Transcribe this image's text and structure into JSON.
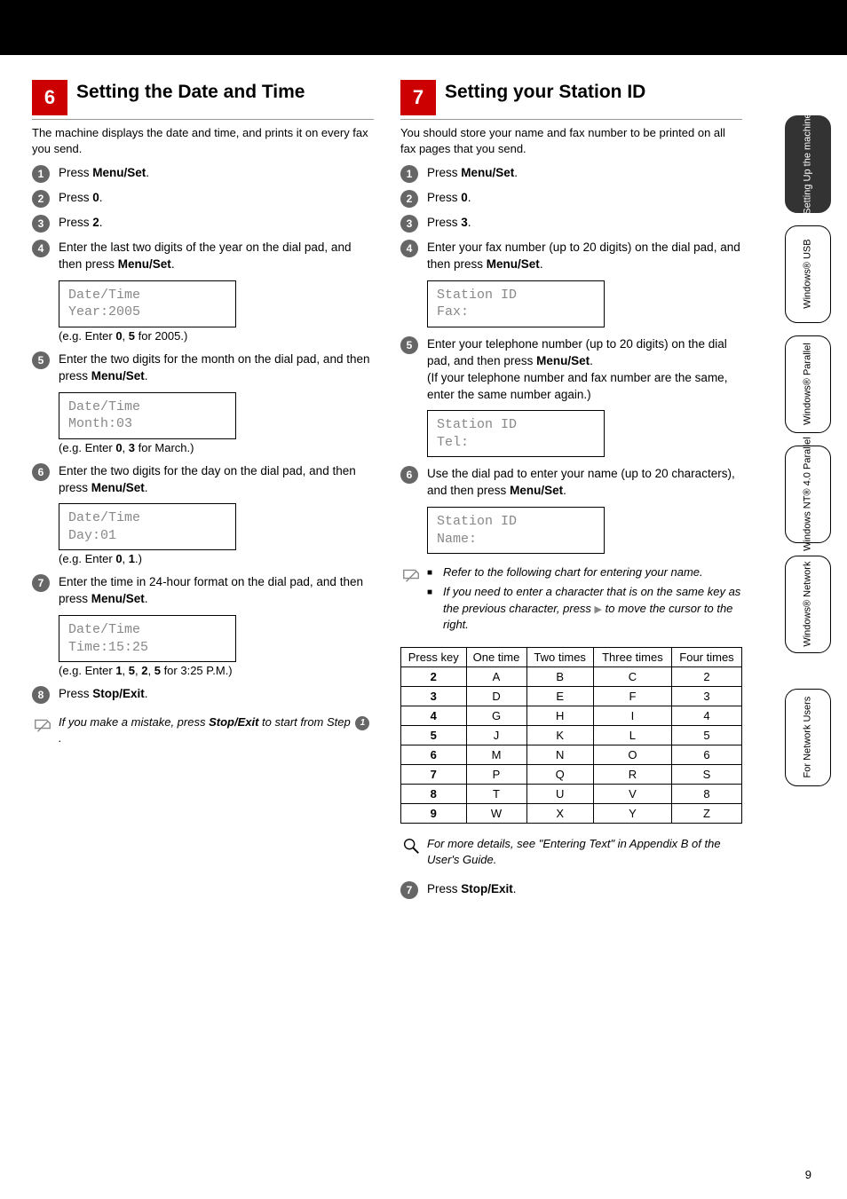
{
  "page_number": "9",
  "left": {
    "section_number": "6",
    "section_title": "Setting the Date and Time",
    "intro": "The machine displays the date and time, and prints it on every fax you send.",
    "steps": {
      "s1": {
        "html": "Press <b>Menu/Set</b>."
      },
      "s2": {
        "html": "Press <b>0</b>."
      },
      "s3": {
        "html": "Press <b>2</b>."
      },
      "s4": {
        "html": "Enter the last two digits of the year on the dial pad, and then press <b>Menu/Set</b>.",
        "lcd": "Date/Time\nYear:2005",
        "eg": "(e.g. Enter <b>0</b>, <b>5</b> for 2005.)"
      },
      "s5": {
        "html": "Enter the two digits for the month on the dial pad, and then press <b>Menu/Set</b>.",
        "lcd": "Date/Time\nMonth:03",
        "eg": "(e.g. Enter <b>0</b>, <b>3</b> for March.)"
      },
      "s6": {
        "html": "Enter the two digits for the day on the dial pad, and then press <b>Menu/Set</b>.",
        "lcd": "Date/Time\nDay:01",
        "eg": "(e.g. Enter <b>0</b>, <b>1</b>.)"
      },
      "s7": {
        "html": "Enter the time in 24-hour format on the dial pad, and then press <b>Menu/Set</b>.",
        "lcd": "Date/Time\nTime:15:25",
        "eg": "(e.g. Enter <b>1</b>, <b>5</b>, <b>2</b>, <b>5</b> for 3:25 P.M.)"
      },
      "s8": {
        "html": "Press <b>Stop/Exit</b>."
      }
    },
    "footnote": {
      "html": "If you make a mistake, press <b>Stop/Exit</b> to start from Step <span class='step-num' style='display:inline-flex;width:16px;height:16px;font-size:10px;vertical-align:middle;margin:0 2px 0 2px;'>1</span>."
    }
  },
  "right": {
    "section_number": "7",
    "section_title": "Setting your Station ID",
    "intro": "You should store your name and fax number to be printed on all fax pages that you send.",
    "steps": {
      "s1": {
        "html": "Press <b>Menu/Set</b>."
      },
      "s2": {
        "html": "Press <b>0</b>."
      },
      "s3": {
        "html": "Press <b>3</b>."
      },
      "s4": {
        "html": "Enter your fax number (up to 20 digits) on the dial pad, and then press <b>Menu/Set</b>.",
        "lcd": "Station ID\nFax:"
      },
      "s5": {
        "html": "Enter your telephone number (up to 20 digits) on the dial pad, and then press <b>Menu/Set</b>.<br>(If your telephone number and fax number are the same, enter the same number again.)",
        "lcd": "Station ID\nTel:"
      },
      "s6": {
        "html": "Use the dial pad to enter your name (up to 20 characters), and then press <b>Menu/Set</b>.",
        "lcd": "Station ID\nName:"
      },
      "s7": {
        "html": "Press <b>Stop/Exit</b>."
      }
    },
    "tipnote": {
      "b1": "Refer to the following chart for entering your name.",
      "b2": "If you need to enter a character that is on the same key as the previous character, press <span class='cursor-glyph'>▶</span> to move the cursor to the right."
    },
    "char_table": {
      "headers": [
        "Press key",
        "One time",
        "Two times",
        "Three times",
        "Four times"
      ],
      "rows": [
        [
          "2",
          "A",
          "B",
          "C",
          "2"
        ],
        [
          "3",
          "D",
          "E",
          "F",
          "3"
        ],
        [
          "4",
          "G",
          "H",
          "I",
          "4"
        ],
        [
          "5",
          "J",
          "K",
          "L",
          "5"
        ],
        [
          "6",
          "M",
          "N",
          "O",
          "6"
        ],
        [
          "7",
          "P",
          "Q",
          "R",
          "S"
        ],
        [
          "8",
          "T",
          "U",
          "V",
          "8"
        ],
        [
          "9",
          "W",
          "X",
          "Y",
          "Z"
        ]
      ]
    },
    "refnote": "For more details, see \"Entering Text\" in Appendix B of the User's Guide."
  },
  "tabs": {
    "t1": "Setting Up\nthe machine",
    "t2": "Windows®\nUSB",
    "t3": "Windows®\nParallel",
    "t4": "Windows\nNT® 4.0\nParallel",
    "t5": "Windows®\nNetwork",
    "t6": "For\nNetwork Users"
  }
}
